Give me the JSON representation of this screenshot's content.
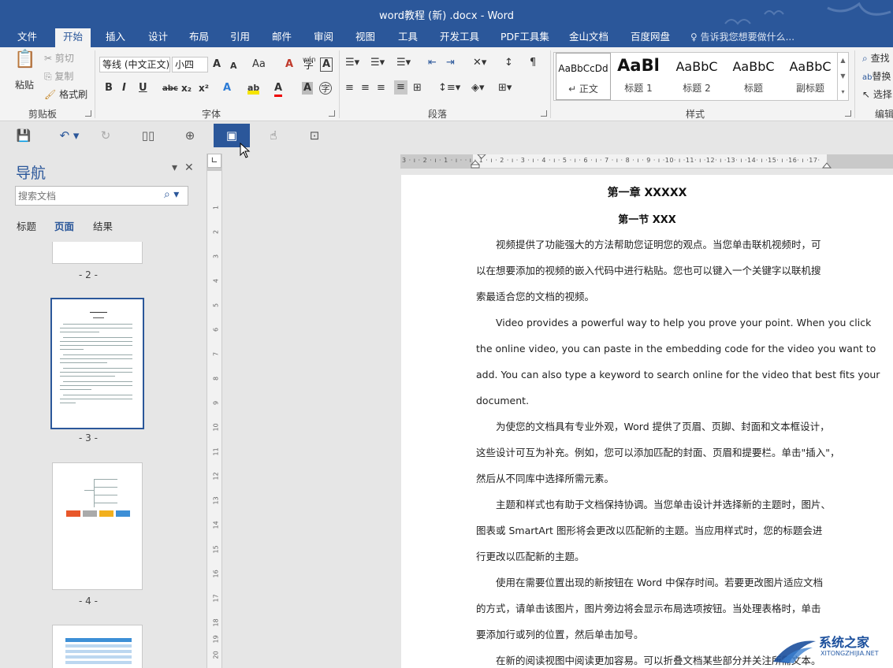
{
  "window": {
    "title": "word教程 (新) .docx - Word"
  },
  "tabs": [
    {
      "label": "文件"
    },
    {
      "label": "开始"
    },
    {
      "label": "插入"
    },
    {
      "label": "设计"
    },
    {
      "label": "布局"
    },
    {
      "label": "引用"
    },
    {
      "label": "邮件"
    },
    {
      "label": "审阅"
    },
    {
      "label": "视图"
    },
    {
      "label": "工具"
    },
    {
      "label": "开发工具"
    },
    {
      "label": "PDF工具集"
    },
    {
      "label": "金山文档"
    },
    {
      "label": "百度网盘"
    }
  ],
  "tell_me": "♀ 告诉我您想要做什么...",
  "ribbon": {
    "clipboard": {
      "paste": "粘贴",
      "cut": "剪切",
      "copy": "复制",
      "format_painter": "格式刷",
      "label": "剪贴板"
    },
    "font": {
      "name": "等线 (中文正文)",
      "size": "小四",
      "grow": "A",
      "shrink": "A",
      "case": "Aa",
      "clear": "A",
      "phonetic_top": "wén",
      "phonetic": "字",
      "border": "A",
      "bold": "B",
      "italic": "I",
      "underline": "U",
      "strike": "abc",
      "sub": "x₂",
      "sup": "x²",
      "effects": "A",
      "highlight": "ab",
      "color": "A",
      "shade": "A",
      "enclose": "字",
      "label": "字体"
    },
    "paragraph": {
      "label": "段落"
    },
    "styles": {
      "items": [
        {
          "preview": "AaBbCcDd",
          "name": "↵ 正文"
        },
        {
          "preview": "AaBl",
          "name": "标题 1"
        },
        {
          "preview": "AaBbC",
          "name": "标题 2"
        },
        {
          "preview": "AaBbC",
          "name": "标题"
        },
        {
          "preview": "AaBbC",
          "name": "副标题"
        }
      ],
      "label": "样式"
    },
    "editing": {
      "find": "查找",
      "replace": "替换",
      "select": "选择",
      "label": "编辑"
    }
  },
  "nav": {
    "title": "导航",
    "search_placeholder": "搜索文档",
    "tabs": [
      "标题",
      "页面",
      "结果"
    ],
    "pages": [
      "- 2 -",
      "- 3 -",
      "- 4 -"
    ]
  },
  "ruler": {
    "horizontal": "3 · ı · 2 · ı · 1 · ı ·  · ı · 1 · ı · 2 · ı · 3 · ı · 4 · ı · 5 · ı · 6 · ı · 7 · ı · 8 · ı · 9 · ı ·10· ı ·11· ı ·12· ı ·13· ı ·14· ı ·15· ı ·16· ı ·17·",
    "vertical": [
      "1",
      "2",
      "3",
      "4",
      "5",
      "6",
      "7",
      "8",
      "9",
      "10",
      "11",
      "12",
      "13",
      "14",
      "15",
      "16",
      "17",
      "18",
      "19",
      "20"
    ]
  },
  "document": {
    "chapter": "第一章 XXXXX",
    "section": "第一节 XXX",
    "lines": [
      "视频提供了功能强大的方法帮助您证明您的观点。当您单击联机视频时，可",
      "以在想要添加的视频的嵌入代码中进行粘贴。您也可以键入一个关键字以联机搜",
      "索最适合您的文档的视频。",
      "Video provides a powerful way to help you prove your point. When you click",
      "the online video, you can paste in the embedding code for the video you want to",
      "add. You can also type a keyword to search online for the video that best fits your",
      "document.",
      "为使您的文档具有专业外观，Word 提供了页眉、页脚、封面和文本框设计，",
      "这些设计可互为补充。例如，您可以添加匹配的封面、页眉和提要栏。单击\"插入\"，",
      "然后从不同库中选择所需元素。",
      "主题和样式也有助于文档保持协调。当您单击设计并选择新的主题时，图片、",
      "图表或 SmartArt 图形将会更改以匹配新的主题。当应用样式时，您的标题会进",
      "行更改以匹配新的主题。",
      "使用在需要位置出现的新按钮在 Word 中保存时间。若要更改图片适应文档",
      "的方式，请单击该图片，图片旁边将会显示布局选项按钮。当处理表格时，单击",
      "要添加行或列的位置，然后单击加号。",
      "在新的阅读视图中阅读更加容易。可以折叠文档某些部分并关注所需文本。"
    ]
  },
  "watermark": {
    "main": "系统之家",
    "sub": "XITONGZHIJIA.NET"
  },
  "colors": {
    "accent": "#2b579a",
    "ribbon_bg": "#f3f3f3",
    "pane_bg": "#e6e6e6"
  }
}
